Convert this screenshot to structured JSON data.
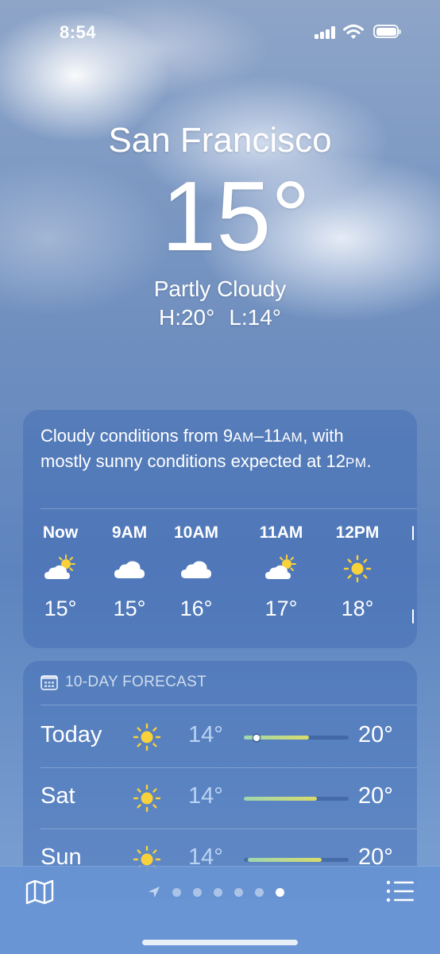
{
  "status_bar": {
    "time": "8:54"
  },
  "location": {
    "city": "San Francisco",
    "temperature": "15°",
    "condition": "Partly Cloudy",
    "high": "H:20°",
    "low": "L:14°"
  },
  "hourly_card": {
    "summary_parts": [
      "Cloudy conditions from 9",
      "AM",
      "–11",
      "AM",
      ", with mostly sunny conditions expected at 12",
      "PM",
      "."
    ],
    "hours": [
      {
        "label": "Now",
        "icon": "partly-cloudy-icon",
        "temp": "15°"
      },
      {
        "label": "9AM",
        "icon": "cloud-icon",
        "temp": "15°"
      },
      {
        "label": "10AM",
        "icon": "cloud-icon",
        "temp": "16°"
      },
      {
        "label": "11AM",
        "icon": "partly-cloudy-icon",
        "temp": "17°"
      },
      {
        "label": "12PM",
        "icon": "sun-icon",
        "temp": "18°"
      }
    ]
  },
  "forecast": {
    "header": "10-DAY FORECAST",
    "days": [
      {
        "day": "Today",
        "icon": "sun-icon",
        "low": "14°",
        "high": "20°",
        "range_start": 0.0,
        "range_end": 0.62,
        "current": 0.12
      },
      {
        "day": "Sat",
        "icon": "sun-icon",
        "low": "14°",
        "high": "20°",
        "range_start": 0.0,
        "range_end": 0.7
      },
      {
        "day": "Sun",
        "icon": "sun-icon",
        "low": "14°",
        "high": "20°",
        "range_start": 0.04,
        "range_end": 0.74
      }
    ]
  },
  "tab_bar": {
    "pages": 6,
    "active_page": 6
  },
  "colors": {
    "sun": "#f8d13b",
    "range_low": "#9fd6b0",
    "range_high": "#d8dc6a",
    "low_temp": "#b9d3f3"
  }
}
